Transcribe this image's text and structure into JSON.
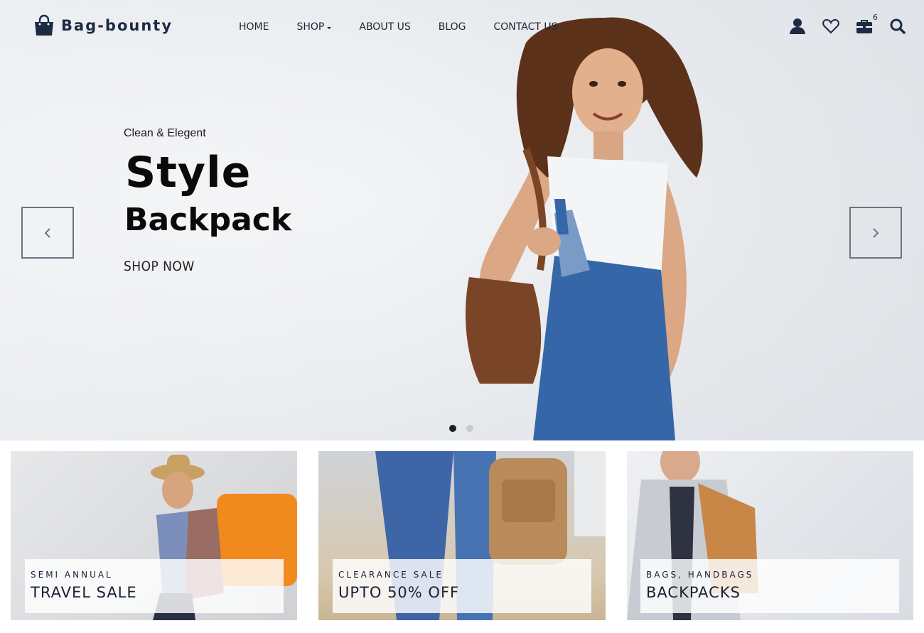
{
  "brand": {
    "name": "Bag-bounty",
    "icon": "shopping-bag-icon"
  },
  "nav": {
    "items": [
      {
        "label": "HOME",
        "has_dropdown": false
      },
      {
        "label": "SHOP",
        "has_dropdown": true
      },
      {
        "label": "ABOUT US",
        "has_dropdown": false
      },
      {
        "label": "BLOG",
        "has_dropdown": false
      },
      {
        "label": "CONTACT US",
        "has_dropdown": false
      }
    ]
  },
  "header_icons": {
    "account": "user-icon",
    "wishlist": "heart-icon",
    "cart": "briefcase-cart-icon",
    "cart_count": "6",
    "search": "search-icon"
  },
  "hero": {
    "subtitle": "Clean & Elegent",
    "headline_line1": "Style",
    "headline_line2": "Backpack",
    "cta": "SHOP NOW",
    "slides": 2,
    "active_slide": 1
  },
  "banners": [
    {
      "small": "SEMI ANNUAL",
      "big": "TRAVEL SALE"
    },
    {
      "small": "CLEARANCE SALE",
      "big": "UPTO 50% OFF"
    },
    {
      "small": "BAGS, HANDBAGS",
      "big": "BACKPACKS"
    }
  ],
  "colors": {
    "brand": "#1d2a44",
    "text": "#0a0a0a",
    "arrow_border": "#6d7283",
    "dot_active": "#1f1f1f",
    "dot_inactive": "#c5c9d0"
  }
}
